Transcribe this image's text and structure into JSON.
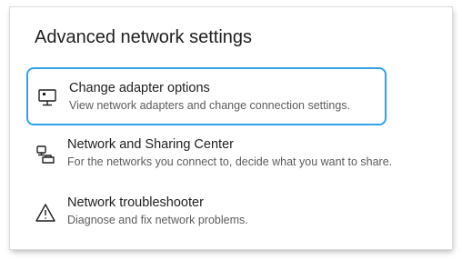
{
  "page": {
    "title": "Advanced network settings"
  },
  "items": [
    {
      "title": "Change adapter options",
      "description": "View network adapters and change connection settings.",
      "icon": "monitor-network-icon",
      "selected": true
    },
    {
      "title": "Network and Sharing Center",
      "description": "For the networks you connect to, decide what you want to share.",
      "icon": "network-sharing-icon",
      "selected": false
    },
    {
      "title": "Network troubleshooter",
      "description": "Diagnose and fix network problems.",
      "icon": "warning-triangle-icon",
      "selected": false
    }
  ],
  "colors": {
    "focus_border": "#2fa3e6",
    "title_text": "#1f1f1f",
    "description_text": "#5c5c5c"
  }
}
